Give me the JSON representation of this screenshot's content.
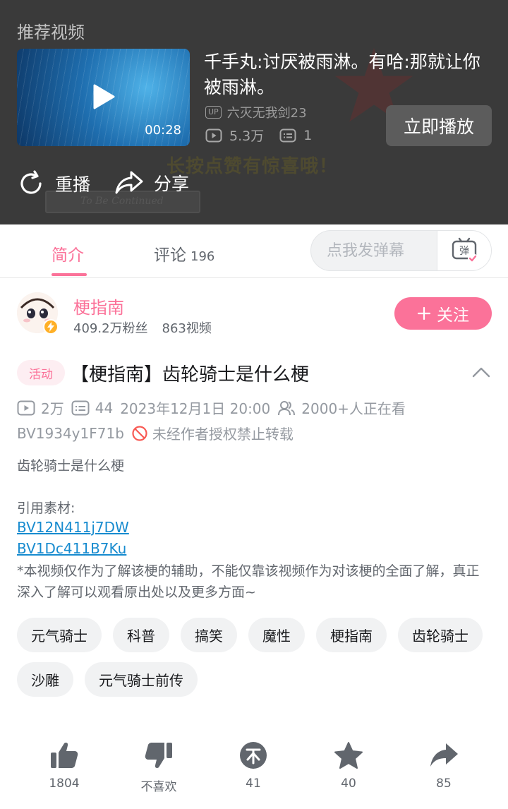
{
  "recommend": {
    "section_title": "推荐视频",
    "video": {
      "duration": "00:28",
      "title": "千手丸:讨厌被雨淋。有哈:那就让你被雨淋。",
      "up_badge": "UP",
      "author": "六灭无我剑23",
      "views": "5.3万",
      "danmaku_count": "1"
    },
    "play_now_label": "立即播放",
    "replay_label": "重播",
    "share_label": "分享",
    "overlay_text": "长按点赞有惊喜哦！",
    "overlay_arrow_text": "To Be Continued"
  },
  "tabs": [
    {
      "label": "简介",
      "active": true
    },
    {
      "label": "评论",
      "count": "196"
    }
  ],
  "danmaku": {
    "placeholder": "点我发弹幕",
    "toggle_icon": "danmaku-toggle-icon",
    "toggle_glyph": "弹"
  },
  "uploader": {
    "name": "梗指南",
    "fans": "409.2万粉丝",
    "videos": "863视频",
    "follow_label": "关注",
    "follow_prefix": "+"
  },
  "video": {
    "activity_tag": "活动",
    "title": "【梗指南】齿轮骑士是什么梗",
    "views": "2万",
    "danmaku": "44",
    "datetime": "2023年12月1日 20:00",
    "watching": "2000+人正在看",
    "bvid": "BV1934y1F71b",
    "copyright": "未经作者授权禁止转载",
    "description": "齿轮骑士是什么梗",
    "references_label": "引用素材:",
    "references": [
      "BV12N411j7DW",
      "BV1Dc411B7Ku"
    ],
    "disclaimer": "*本视频仅作为了解该梗的辅助，不能仅靠该视频作为对该梗的全面了解，真正深入了解可以观看原出处以及更多方面~"
  },
  "tags": [
    "元气骑士",
    "科普",
    "搞笑",
    "魔性",
    "梗指南",
    "齿轮骑士",
    "沙雕",
    "元气骑士前传"
  ],
  "actions": [
    {
      "icon": "thumbs-up-icon",
      "label": "1804"
    },
    {
      "icon": "thumbs-down-icon",
      "label": "不喜欢"
    },
    {
      "icon": "coin-icon",
      "label": "41"
    },
    {
      "icon": "star-icon",
      "label": "40"
    },
    {
      "icon": "share-icon",
      "label": "85"
    }
  ],
  "colors": {
    "accent": "#fb7299",
    "link": "#178bcf",
    "overlay_bg": "#3a3a3a",
    "icon_gray": "#61666d"
  }
}
